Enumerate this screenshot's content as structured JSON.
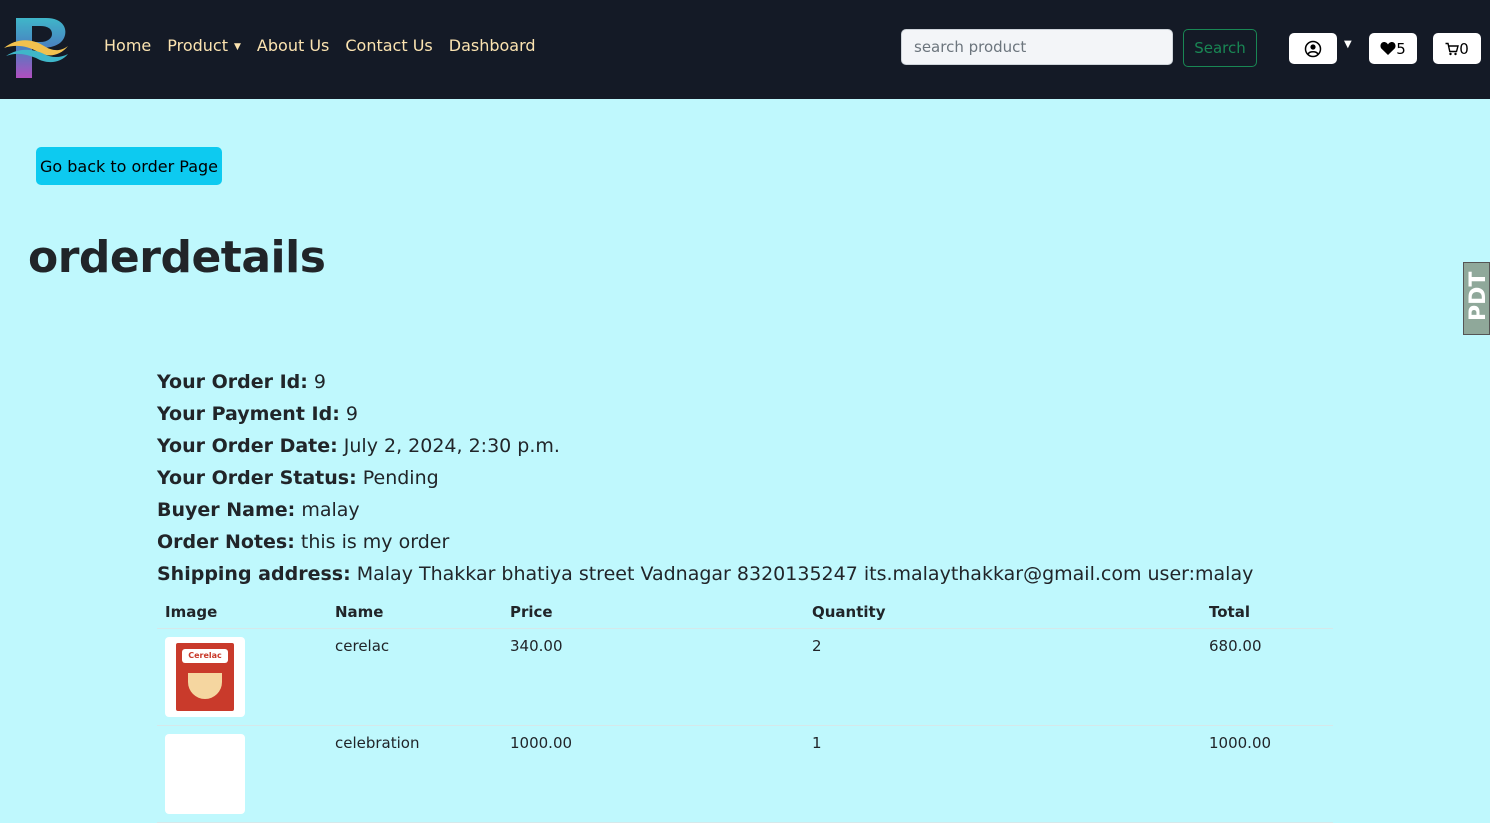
{
  "nav": {
    "links": [
      "Home",
      "Product",
      "About Us",
      "Contact Us",
      "Dashboard"
    ],
    "search_placeholder": "search product",
    "search_button": "Search",
    "wishlist_count": "5",
    "cart_count": "0"
  },
  "back_button": "Go back to order Page",
  "page_title": "orderdetails",
  "side_tab_text": "PDT",
  "details": [
    {
      "label": "Your Order Id:",
      "value": "9"
    },
    {
      "label": "Your Payment Id:",
      "value": "9"
    },
    {
      "label": "Your Order Date:",
      "value": "July 2, 2024, 2:30 p.m."
    },
    {
      "label": "Your Order Status:",
      "value": "Pending"
    },
    {
      "label": "Buyer Name:",
      "value": "malay"
    },
    {
      "label": "Order Notes:",
      "value": "this is my order"
    },
    {
      "label": "Shipping address:",
      "value": "Malay Thakkar bhatiya street Vadnagar 8320135247 its.malaythakkar@gmail.com user:malay"
    }
  ],
  "table": {
    "headers": [
      "Image",
      "Name",
      "Price",
      "Quantity",
      "Total"
    ],
    "rows": [
      {
        "image_label": "Cerelac",
        "name": "cerelac",
        "price": "340.00",
        "quantity": "2",
        "total": "680.00"
      },
      {
        "image_label": "",
        "name": "celebration",
        "price": "1000.00",
        "quantity": "1",
        "total": "1000.00"
      }
    ]
  },
  "colors": {
    "navbar": "#141a26",
    "page_bg": "#bff8fd",
    "nav_link": "#fbe3b0",
    "search_btn": "#198754",
    "back_btn": "#0dcaf0"
  }
}
